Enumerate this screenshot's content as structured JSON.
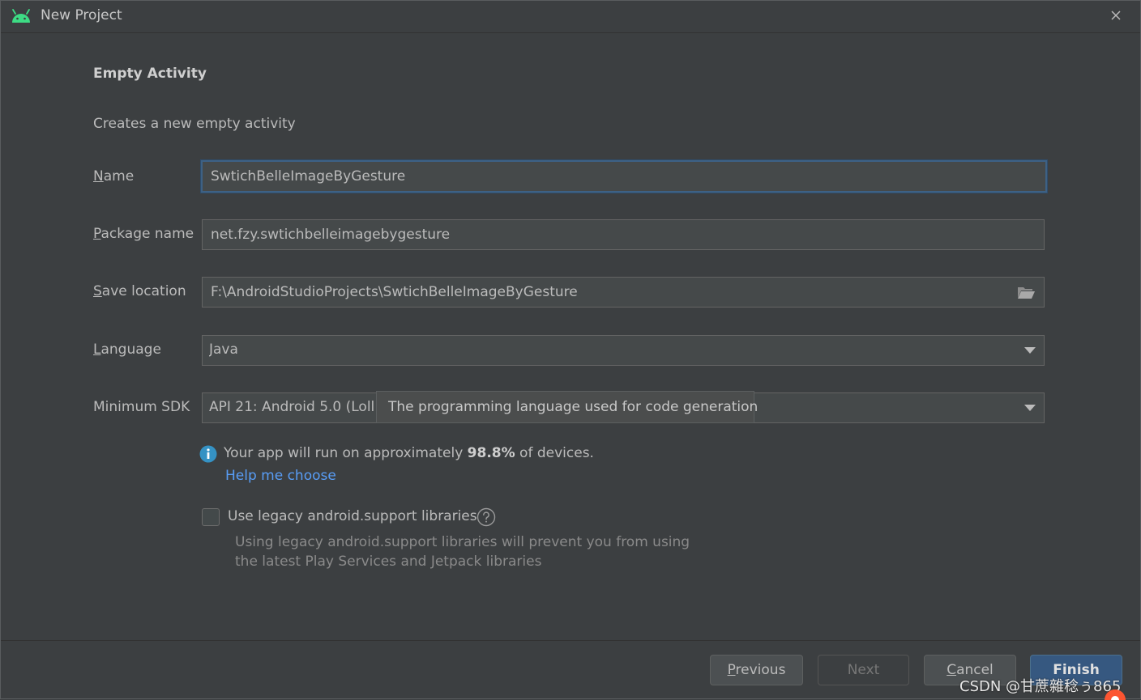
{
  "window": {
    "title": "New Project",
    "accent": "#3ddc84"
  },
  "content": {
    "heading": "Empty Activity",
    "subtitle": "Creates a new empty activity"
  },
  "form": {
    "name": {
      "label_underlined": "N",
      "label_rest": "ame",
      "value": "SwtichBelleImageByGesture"
    },
    "package": {
      "label_underlined": "P",
      "label_rest": "ackage name",
      "value": "net.fzy.swtichbelleimagebygesture"
    },
    "location": {
      "label_underlined": "S",
      "label_rest": "ave location",
      "value": "F:\\AndroidStudioProjects\\SwtichBelleImageByGesture"
    },
    "language": {
      "label_underlined": "L",
      "label_rest": "anguage",
      "value": "Java"
    },
    "min_sdk": {
      "label": "Minimum SDK",
      "value": "API 21: Android 5.0 (Lollipop)"
    }
  },
  "tooltip": "The programming language used for code generation",
  "info": {
    "prefix": "Your app will run on approximately ",
    "percent": "98.8%",
    "suffix": " of devices.",
    "help_link": "Help me choose"
  },
  "legacy": {
    "checkbox_label": "Use legacy android.support libraries",
    "checked": false,
    "note_line1": "Using legacy android.support libraries will prevent you from using",
    "note_line2": "the latest Play Services and Jetpack libraries"
  },
  "buttons": {
    "previous_u": "P",
    "previous_rest": "revious",
    "next": "Next",
    "cancel_u": "C",
    "cancel_rest": "ancel",
    "finish": "Finish"
  },
  "watermark": "CSDN @甘蔗雜稔ぅ865"
}
